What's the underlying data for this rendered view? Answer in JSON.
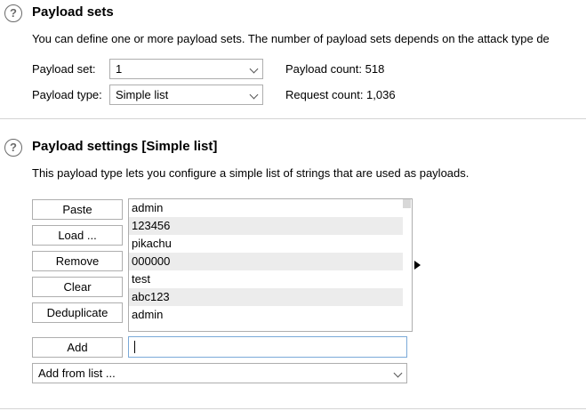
{
  "payload_sets": {
    "title": "Payload sets",
    "description": "You can define one or more payload sets. The number of payload sets depends on the attack type de",
    "set_label": "Payload set:",
    "set_value": "1",
    "type_label": "Payload type:",
    "type_value": "Simple list",
    "payload_count": "Payload count: 518",
    "request_count": "Request count: 1,036"
  },
  "payload_settings": {
    "title": "Payload settings [Simple list]",
    "description": "This payload type lets you configure a simple list of strings that are used as payloads.",
    "buttons": {
      "paste": "Paste",
      "load": "Load ...",
      "remove": "Remove",
      "clear": "Clear",
      "deduplicate": "Deduplicate",
      "add": "Add"
    },
    "list_items": [
      "admin",
      "123456",
      "pikachu",
      "000000",
      "test",
      "abc123",
      "admin"
    ],
    "add_input_value": "",
    "add_from_list": "Add from list ..."
  },
  "icons": {
    "help": "?",
    "help_name": "help-icon",
    "arrow_name": "arrow-right-icon"
  }
}
